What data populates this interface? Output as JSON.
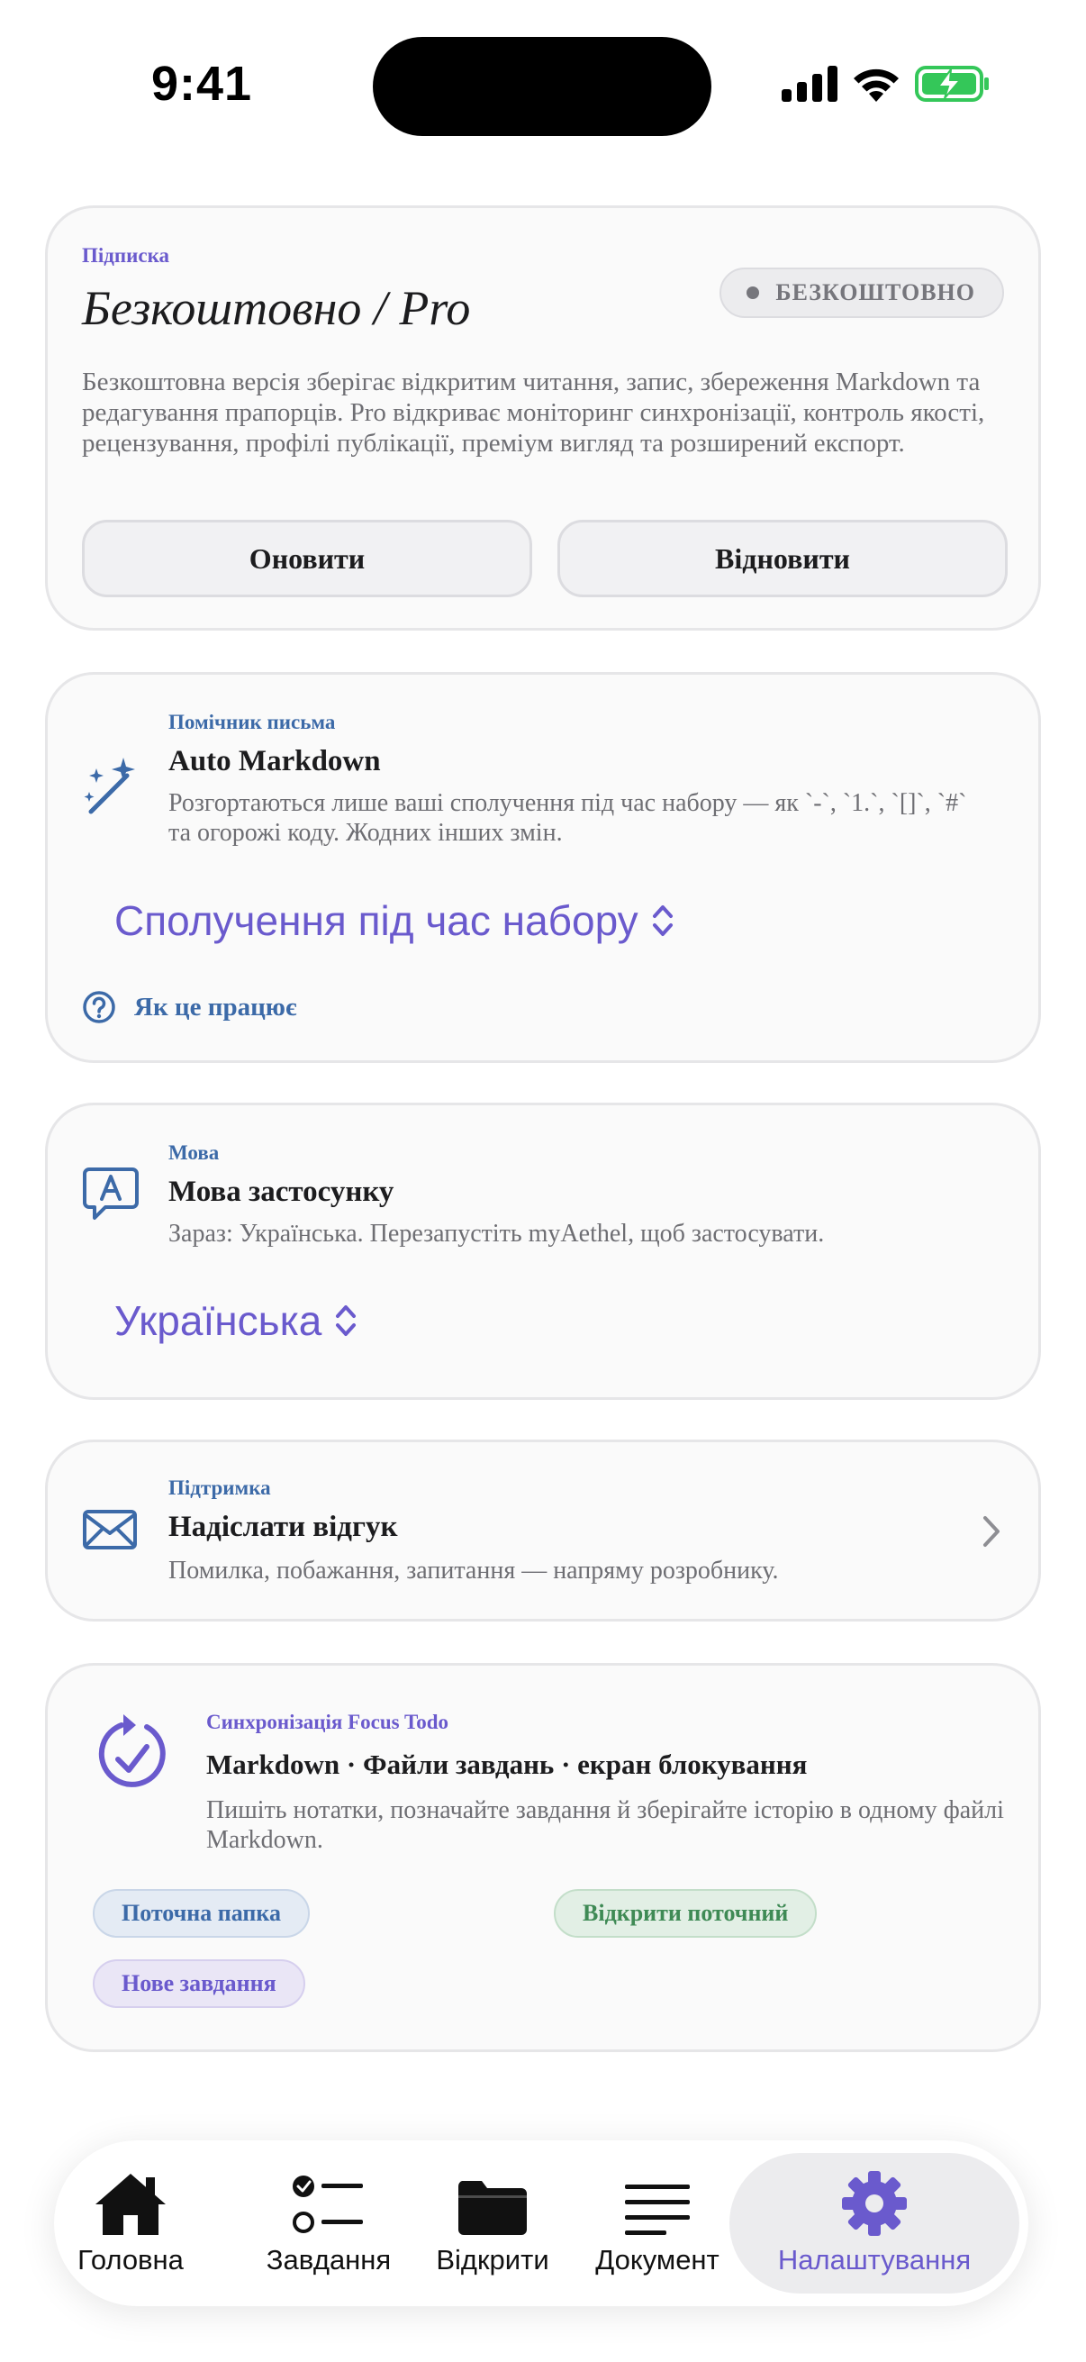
{
  "status_bar": {
    "time": "9:41"
  },
  "subscription": {
    "eyebrow": "Підписка",
    "title": "Безкоштовно / Pro",
    "badge": "БЕЗКОШТОВНО",
    "description": "Безкоштовна версія зберігає відкритим читання, запис, збереження Markdown та редагування прапорців. Pro відкриває моніторинг синхронізації, контроль якості, рецензування, профілі публікації, преміум вигляд та розширений експорт.",
    "upgrade_label": "Оновити",
    "restore_label": "Відновити"
  },
  "writing_helper": {
    "eyebrow": "Помічник письма",
    "title": "Auto Markdown",
    "description": "Розгортаються лише ваші сполучення під час набору — як `-`, `1.`, `[]`, `#` та огорожі коду. Жодних інших змін.",
    "picker_value": "Сполучення під час набору",
    "how_label": "Як це працює"
  },
  "language": {
    "eyebrow": "Мова",
    "title": "Мова застосунку",
    "description": "Зараз: Українська. Перезапустіть myAethel, щоб застосувати.",
    "picker_value": "Українська"
  },
  "support": {
    "eyebrow": "Підтримка",
    "title": "Надіслати відгук",
    "description": "Помилка, побажання, запитання — напряму розробнику."
  },
  "focus_todo": {
    "eyebrow": "Синхронізація Focus Todo",
    "title": "Markdown · Файли завдань · екран блокування",
    "description": "Пишіть нотатки, позначайте завдання й зберігайте історію в одному файлі Markdown.",
    "current_folder": "Поточна папка",
    "open_current": "Відкрити поточний",
    "new_task": "Нове завдання"
  },
  "tabs": [
    {
      "label": "Головна",
      "icon": "house-icon"
    },
    {
      "label": "Завдання",
      "icon": "checklist-icon"
    },
    {
      "label": "Відкрити",
      "icon": "folder-icon"
    },
    {
      "label": "Документ",
      "icon": "text-lines-icon"
    },
    {
      "label": "Налаштування",
      "icon": "gear-icon",
      "active": true
    }
  ],
  "colors": {
    "accent_purple": "#6a5acd",
    "accent_blue": "#3c6aa8",
    "accent_green": "#3f8a55",
    "battery_green": "#34c759"
  }
}
